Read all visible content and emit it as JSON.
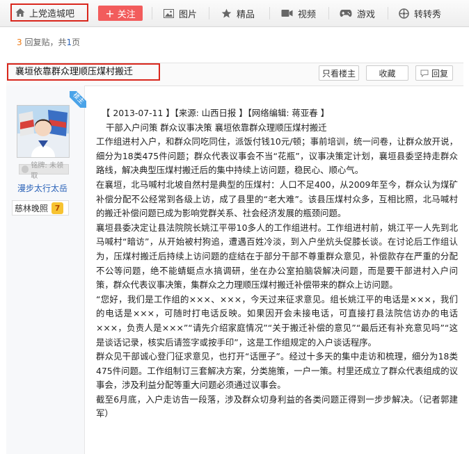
{
  "nav": {
    "home_label": "上党造城吧",
    "follow_label": "关注",
    "items": [
      "图片",
      "精品",
      "视频",
      "游戏",
      "转转秀"
    ]
  },
  "reply_info": {
    "count": "3",
    "label": "回复贴，共",
    "pages": "1",
    "pages_suffix": "页"
  },
  "post": {
    "title": "襄垣依靠群众理顺压煤村搬迁",
    "only_host_label": "只看楼主",
    "favorite_label": "收藏",
    "reply_label": "回复"
  },
  "author": {
    "host_tag": "楼主",
    "medal_label": "铭牌: 未领取",
    "username": "漫步太行太岳",
    "forum_badge": "慈林晚照",
    "level": "7"
  },
  "article": {
    "header": "【 2013-07-11 】【来源: 山西日报 】【网络编辑:  蒋亚春 】",
    "subtitle": "干部入户问策 群众议事决策 襄垣依靠群众理顺压煤村搬迁",
    "paragraphs": [
      "工作组进村入户，和群众同吃同住，派饭付钱10元/顿；事前培训，统一问卷，让群众放开说，细分为18类475件问题；群众代表议事会不当“花瓶”，议事决策定计划，襄垣县委坚持走群众路线，解决典型压煤村搬迁后的集中持续上访问题，稳民心、顺心气。",
      "在襄垣，北马喊村北坡自然村是典型的压煤村：人口不足400，从2009年至今，群众认为煤矿补偿分配不公经常到各级上访，成了县里的“老大难”。该县压煤村众多，互相比照，北马喊村的搬迁补偿问题已成为影响党群关系、社会经济发展的瓶颈问题。",
      "襄垣县委决定让县法院院长姚江平带10多人的工作组进村。工作组进村前，姚江平一人先到北马喊村“暗访”，从开始被村狗追，遭遇百姓冷淡，到入户坐炕头促膝长谈。在讨论后工作组认为，压煤村搬迁后持续上访问题的症结在于部分干部不尊重群众意见，补偿款存在严重的分配不公等问题，绝不能蜻蜓点水搞调研，坐在办公室拍脑袋解决问题，而是要干部进村入户问策，群众代表议事决策，集群众之力理顺压煤村搬迁补偿带来的群众上访问题。",
      "“您好，我们是工作组的×××、×××，今天过来征求意见。组长姚江平的电话是×××，我们的电话是×××，可随时打电话反映。如果因开会未接电话，可直接打县法院信访办的电话×××，负责人是×××”“请先介绍家庭情况”“关于搬迁补偿的意见”“最后还有补充意见吗”“这是谈话记录，核实后请签字或按手印”，这是工作组规定的入户谈话程序。",
      "群众见干部诚心登门征求意见，也打开“话匣子”。经过十多天的集中走访和梳理，细分为18类475件问题。工作组制订三套解决方案，分类施策，一户一策。村里还成立了群众代表组成的议事会，涉及利益分配等重大问题必须通过议事会。",
      "截至6月底，入户走访告一段落，涉及群众切身利益的各类问题正得到一步步解决。（记者郭建军）"
    ]
  },
  "colors": {
    "accent_red": "#d9261c",
    "follow_bg": "#f25c5c",
    "link_blue": "#2a62b8",
    "count_orange": "#f07b15"
  }
}
